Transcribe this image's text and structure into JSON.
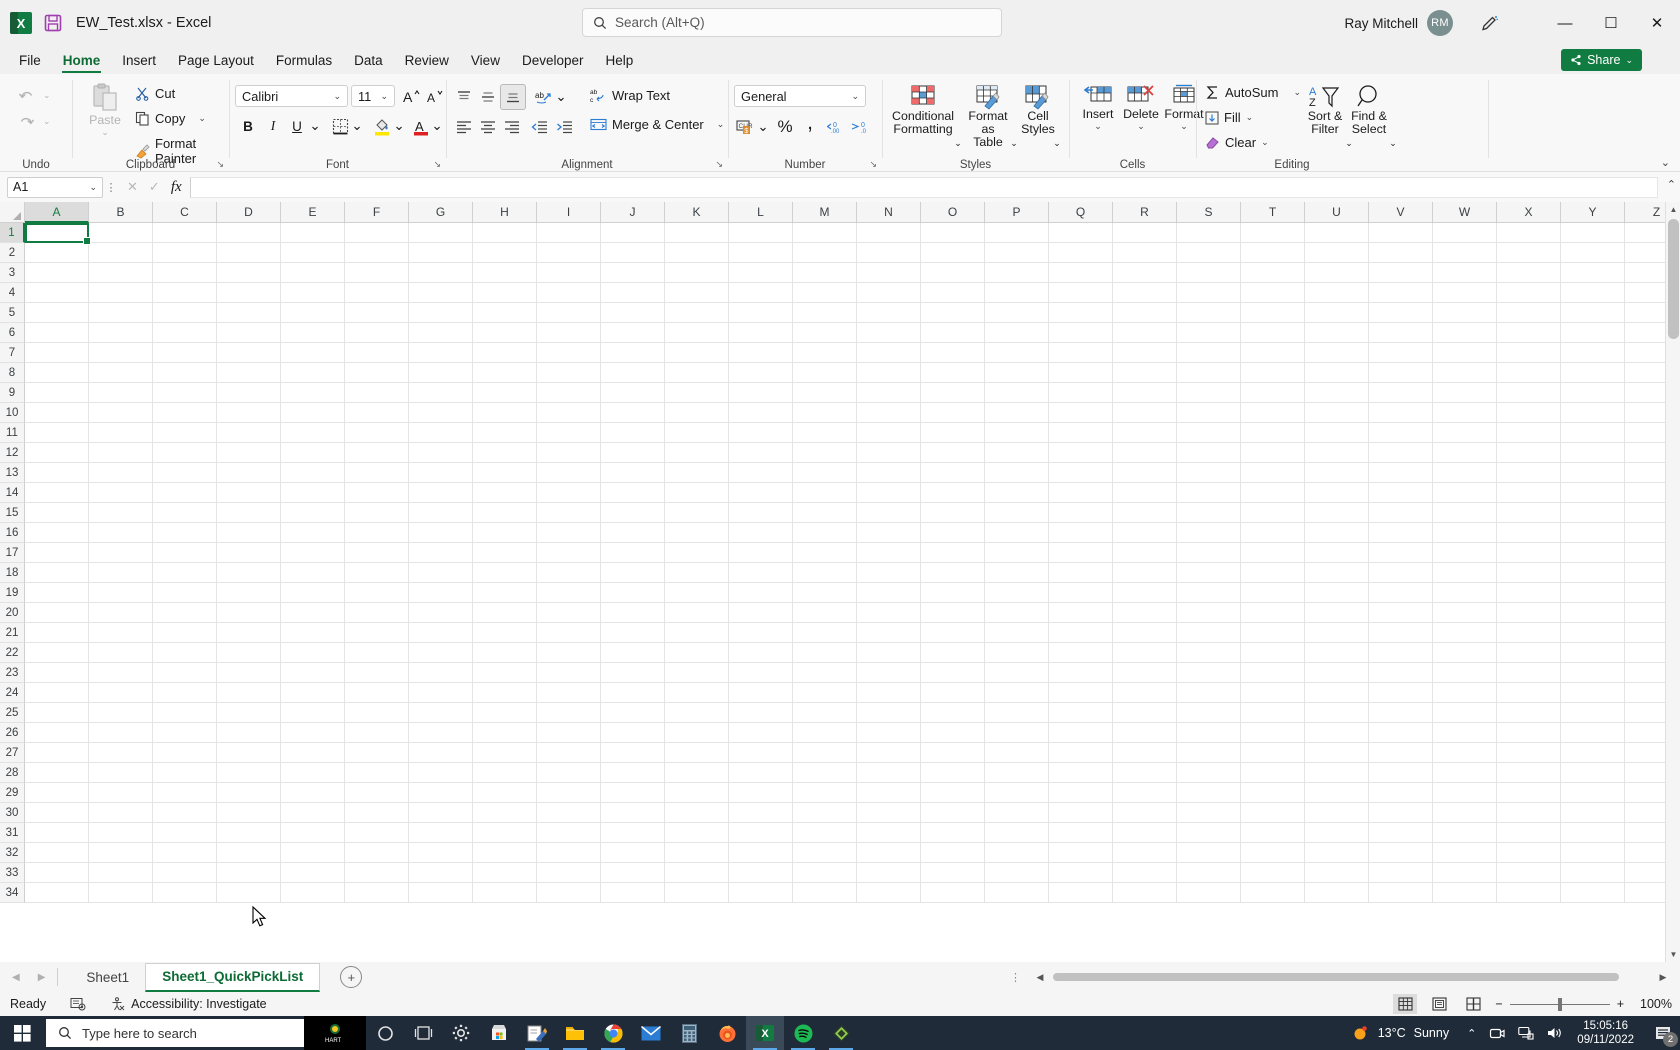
{
  "window": {
    "title": "EW_Test.xlsx  -  Excel",
    "app_icon": "excel-icon",
    "save_icon": "save-icon",
    "minimize": "—",
    "maximize": "☐",
    "close": "✕"
  },
  "search": {
    "placeholder": "Search (Alt+Q)",
    "icon": "search-icon"
  },
  "account": {
    "name": "Ray Mitchell",
    "initials": "RM",
    "ink_icon": "pen-ink-icon"
  },
  "ribbon": {
    "tabs": [
      {
        "label": "File",
        "active": false
      },
      {
        "label": "Home",
        "active": true
      },
      {
        "label": "Insert",
        "active": false
      },
      {
        "label": "Page Layout",
        "active": false
      },
      {
        "label": "Formulas",
        "active": false
      },
      {
        "label": "Data",
        "active": false
      },
      {
        "label": "Review",
        "active": false
      },
      {
        "label": "View",
        "active": false
      },
      {
        "label": "Developer",
        "active": false
      },
      {
        "label": "Help",
        "active": false
      }
    ],
    "share": {
      "label": "Share",
      "icon": "share-icon",
      "caret": "⌄",
      "color": "#107c41"
    },
    "collapse_caret": "⌄",
    "groups": {
      "undo": {
        "label": "Undo",
        "undo_icon": "undo-arrow-icon",
        "redo_icon": "redo-arrow-icon",
        "caret": "⌄"
      },
      "clipboard": {
        "label": "Clipboard",
        "paste": "Paste",
        "cut": "Cut",
        "copy": "Copy",
        "format_painter": "Format Painter",
        "dialog_launcher": "↘"
      },
      "font": {
        "label": "Font",
        "font_name": "Calibri",
        "font_size": "11",
        "grow_font": "A",
        "shrink_font": "A",
        "bold": "B",
        "italic": "I",
        "underline": "U",
        "dialog_launcher": "↘"
      },
      "alignment": {
        "label": "Alignment",
        "wrap_text": "Wrap Text",
        "merge_center": "Merge & Center",
        "dialog_launcher": "↘"
      },
      "number": {
        "label": "Number",
        "format": "General",
        "percent": "%",
        "comma": "ʔ",
        "dialog_launcher": "↘"
      },
      "styles": {
        "label": "Styles",
        "conditional_formatting": "Conditional\nFormatting",
        "conditional_formatting_l1": "Conditional",
        "conditional_formatting_l2": "Formatting",
        "format_as_table_l1": "Format as",
        "format_as_table_l2": "Table",
        "cell_styles_l1": "Cell",
        "cell_styles_l2": "Styles",
        "caret": "⌄"
      },
      "cells": {
        "label": "Cells",
        "insert": "Insert",
        "delete": "Delete",
        "format": "Format",
        "caret": "⌄"
      },
      "editing": {
        "label": "Editing",
        "autosum": "AutoSum",
        "fill": "Fill",
        "clear": "Clear",
        "sort_filter_l1": "Sort &",
        "sort_filter_l2": "Filter",
        "find_select_l1": "Find &",
        "find_select_l2": "Select",
        "caret": "⌄"
      }
    }
  },
  "formula_bar": {
    "name_box": "A1",
    "caret": "⌄",
    "cancel_icon": "cancel-icon",
    "enter_icon": "check-icon",
    "fx_icon": "fx",
    "value": "",
    "expand_caret": "⌃"
  },
  "grid": {
    "columns": [
      "A",
      "B",
      "C",
      "D",
      "E",
      "F",
      "G",
      "H",
      "I",
      "J",
      "K",
      "L",
      "M",
      "N",
      "O",
      "P",
      "Q",
      "R",
      "S",
      "T",
      "U",
      "V",
      "W",
      "X",
      "Y",
      "Z"
    ],
    "rows": [
      1,
      2,
      3,
      4,
      5,
      6,
      7,
      8,
      9,
      10,
      11,
      12,
      13,
      14,
      15,
      16,
      17,
      18,
      19,
      20,
      21,
      22,
      23,
      24,
      25,
      26,
      27,
      28,
      29,
      30,
      31,
      32,
      33,
      34
    ],
    "selected_cell": "A1",
    "selected_column": "A",
    "selected_row": 1,
    "accent_color": "#107c41"
  },
  "sheets": {
    "nav_prev": "◀",
    "nav_next": "▶",
    "tabs": [
      {
        "label": "Sheet1",
        "active": false
      },
      {
        "label": "Sheet1_QuickPickList",
        "active": true
      }
    ],
    "add_sheet": "+"
  },
  "status_bar": {
    "mode": "Ready",
    "macro_icon": "macro-record-icon",
    "accessibility": "Accessibility: Investigate",
    "accessibility_icon": "accessibility-icon",
    "views": [
      {
        "name": "normal-view",
        "active": true
      },
      {
        "name": "page-layout-view",
        "active": false
      },
      {
        "name": "page-break-view",
        "active": false
      }
    ],
    "zoom_out": "−",
    "zoom_in": "+",
    "zoom_level": "100%"
  },
  "taskbar": {
    "start_icon": "windows-start-icon",
    "search_placeholder": "Type here to search",
    "search_icon": "search-icon",
    "apps": [
      {
        "name": "taskbar-app-hart",
        "running": false
      },
      {
        "name": "cortana-icon",
        "running": false
      },
      {
        "name": "task-view-icon",
        "running": false
      },
      {
        "name": "settings-gear-icon",
        "running": false
      },
      {
        "name": "microsoft-store-icon",
        "running": false
      },
      {
        "name": "snipping-tool-icon",
        "running": true
      },
      {
        "name": "file-explorer-icon",
        "running": true
      },
      {
        "name": "google-chrome-icon",
        "running": true
      },
      {
        "name": "mail-icon",
        "running": false
      },
      {
        "name": "calculator-icon",
        "running": false
      },
      {
        "name": "firefox-icon",
        "running": false
      },
      {
        "name": "excel-icon",
        "running": true
      },
      {
        "name": "spotify-icon",
        "running": true
      },
      {
        "name": "green-diamond-app-icon",
        "running": true
      }
    ],
    "weather": {
      "temperature": "13°C",
      "condition": "Sunny"
    },
    "tray_caret": "⌃",
    "clock_time": "15:05:16",
    "clock_date": "09/11/2022",
    "notification_count": "2"
  }
}
